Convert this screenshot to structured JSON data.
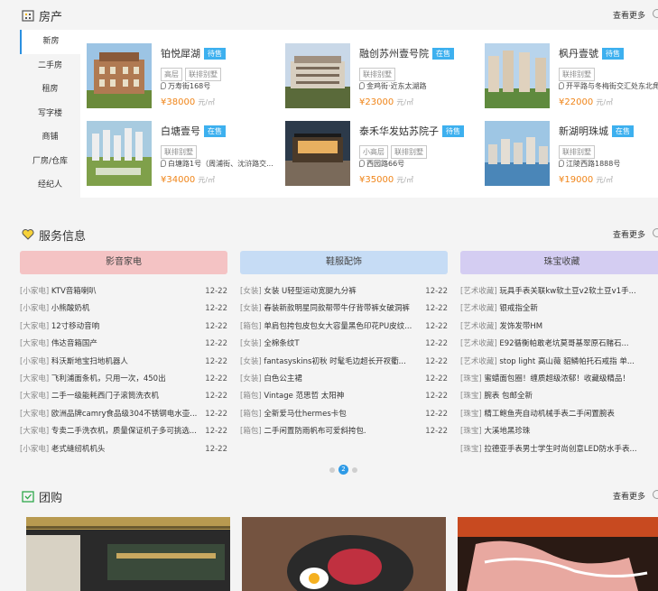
{
  "property": {
    "title": "房产",
    "more": "查看更多",
    "tabs": [
      "新房",
      "二手房",
      "租房",
      "写字楼",
      "商铺",
      "厂房/仓库",
      "经纪人"
    ],
    "cards": [
      {
        "name": "铂悦犀湖",
        "status": "待售",
        "tags": [
          "高层",
          "联排别墅"
        ],
        "addr": "万寿街168号",
        "price": "38000",
        "unit": "元/㎡"
      },
      {
        "name": "融创苏州壹号院",
        "status": "在售",
        "tags": [
          "联排别墅"
        ],
        "addr": "金鸡街·近东太湖路",
        "price": "23000",
        "unit": "元/㎡"
      },
      {
        "name": "枫丹壹號",
        "status": "待售",
        "tags": [
          "联排别墅"
        ],
        "addr": "开平路与冬梅街交汇处东北角",
        "price": "22000",
        "unit": "元/㎡"
      },
      {
        "name": "白塘壹号",
        "status": "在售",
        "tags": [
          "联排别墅"
        ],
        "addr": "白塘路1号（周浦街、沈浒路交...",
        "price": "34000",
        "unit": "元/㎡"
      },
      {
        "name": "泰禾华发姑苏院子",
        "status": "待售",
        "tags": [
          "小高层",
          "联排别墅"
        ],
        "addr": "西园路66号",
        "price": "35000",
        "unit": "元/㎡"
      },
      {
        "name": "新湖明珠城",
        "status": "在售",
        "tags": [
          "联排别墅"
        ],
        "addr": "江陵西路1888号",
        "price": "19000",
        "unit": "元/㎡"
      }
    ]
  },
  "service": {
    "title": "服务信息",
    "more": "查看更多",
    "columns": [
      {
        "title": "影音家电",
        "color": "#f4c3c4",
        "rows": [
          [
            "[小家电]",
            "KTV音箱喇叭",
            "12-22"
          ],
          [
            "[小家电]",
            "小熊酸奶机",
            "12-22"
          ],
          [
            "[大家电]",
            "12寸移动音响",
            "12-22"
          ],
          [
            "[大家电]",
            "伟达音箱国产",
            "12-22"
          ],
          [
            "[小家电]",
            "科沃斯地宝扫地机器人",
            "12-22"
          ],
          [
            "[大家电]",
            "飞利浦面条机，只用一次，450出",
            "12-22"
          ],
          [
            "[大家电]",
            "二手一级能耗西门子滚筒洗衣机",
            "12-22"
          ],
          [
            "[大家电]",
            "欧洲品牌camry食品级304不锈钢电水壶...",
            "12-22"
          ],
          [
            "[大家电]",
            "专卖二手洗衣机，质量保证机子多可挑选...",
            "12-22"
          ],
          [
            "[小家电]",
            "老式缝纫机机头",
            "12-22"
          ]
        ]
      },
      {
        "title": "鞋服配饰",
        "color": "#c6dcf5",
        "rows": [
          [
            "[女装]",
            "女装 U轻型运动宽腿九分裤",
            "12-22"
          ],
          [
            "[女装]",
            "春装新款明星同款帮带牛仔背带裤女破洞裤",
            "12-22"
          ],
          [
            "[箱包]",
            "单肩包挎包皮包女大容量黑色印花PU皮纹...",
            "12-22"
          ],
          [
            "[女装]",
            "全棉条纹T",
            "12-22"
          ],
          [
            "[女装]",
            "fantasyskins初秋 时髦毛边超长开衩衢...",
            "12-22"
          ],
          [
            "[女装]",
            "白色公主裙",
            "12-22"
          ],
          [
            "[箱包]",
            "Vintage 范思哲 太阳神",
            "12-22"
          ],
          [
            "[箱包]",
            "全新爱马仕hermes卡包",
            "12-22"
          ],
          [
            "[箱包]",
            "二手闲置防雨帆布可爱斜挎包.",
            "12-22"
          ]
        ]
      },
      {
        "title": "珠宝收藏",
        "color": "#d4cdf2",
        "rows": [
          [
            "[艺术收藏]",
            "玩具手表关联kw软土豆v2软土豆v1手...",
            "12-22"
          ],
          [
            "[艺术收藏]",
            "银戒指全新",
            "12-22"
          ],
          [
            "[艺术收藏]",
            "发饰发带HM",
            "12-22"
          ],
          [
            "[艺术收藏]",
            "E92循衡帕敢老坑莫哥基翠原石赌石...",
            "12-22"
          ],
          [
            "[艺术收藏]",
            "stop light 高山薇 貂鳞帕托石戒指 单...",
            "12-22"
          ],
          [
            "[珠宝]",
            "蜜蜡面包圈！缠质超级浓郁！收藏级精品！",
            "12-22"
          ],
          [
            "[珠宝]",
            "腕表 包邮全新",
            "12-22"
          ],
          [
            "[珠宝]",
            "精工鲍鱼壳自动机械手表二手闲置腕表",
            "12-22"
          ],
          [
            "[珠宝]",
            "大溪地黑珍珠",
            "12-22"
          ],
          [
            "[珠宝]",
            "拉德亚手表男士学生时尚创意LED防水手表...",
            "12-22"
          ]
        ]
      }
    ],
    "pagination": {
      "current": "2"
    }
  },
  "group": {
    "title": "团购",
    "more": "查看更多"
  }
}
